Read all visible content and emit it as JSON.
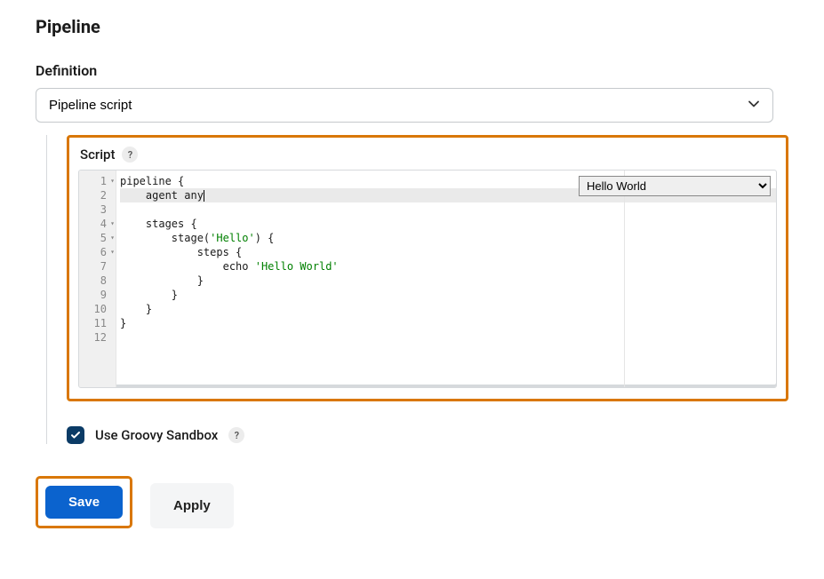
{
  "title": "Pipeline",
  "definition": {
    "label": "Definition",
    "selected": "Pipeline script"
  },
  "script": {
    "label": "Script",
    "sample_selected": "Hello World",
    "lines": [
      {
        "n": 1,
        "fold": true,
        "indent": 0,
        "text": "pipeline {",
        "active": false
      },
      {
        "n": 2,
        "fold": false,
        "indent": 1,
        "text": "agent any",
        "active": true
      },
      {
        "n": 3,
        "fold": false,
        "indent": 0,
        "text": "",
        "active": false
      },
      {
        "n": 4,
        "fold": true,
        "indent": 1,
        "text": "stages {",
        "active": false
      },
      {
        "n": 5,
        "fold": true,
        "indent": 2,
        "text_pre": "stage(",
        "text_str": "'Hello'",
        "text_post": ") {",
        "active": false
      },
      {
        "n": 6,
        "fold": true,
        "indent": 3,
        "text": "steps {",
        "active": false
      },
      {
        "n": 7,
        "fold": false,
        "indent": 4,
        "text_pre": "echo ",
        "text_str": "'Hello World'",
        "text_post": "",
        "active": false
      },
      {
        "n": 8,
        "fold": false,
        "indent": 3,
        "text": "}",
        "active": false
      },
      {
        "n": 9,
        "fold": false,
        "indent": 2,
        "text": "}",
        "active": false
      },
      {
        "n": 10,
        "fold": false,
        "indent": 1,
        "text": "}",
        "active": false
      },
      {
        "n": 11,
        "fold": false,
        "indent": 0,
        "text": "}",
        "active": false
      },
      {
        "n": 12,
        "fold": false,
        "indent": 0,
        "text": "",
        "active": false
      }
    ]
  },
  "sandbox": {
    "checked": true,
    "label": "Use Groovy Sandbox"
  },
  "buttons": {
    "save": "Save",
    "apply": "Apply"
  },
  "help_glyph": "?"
}
